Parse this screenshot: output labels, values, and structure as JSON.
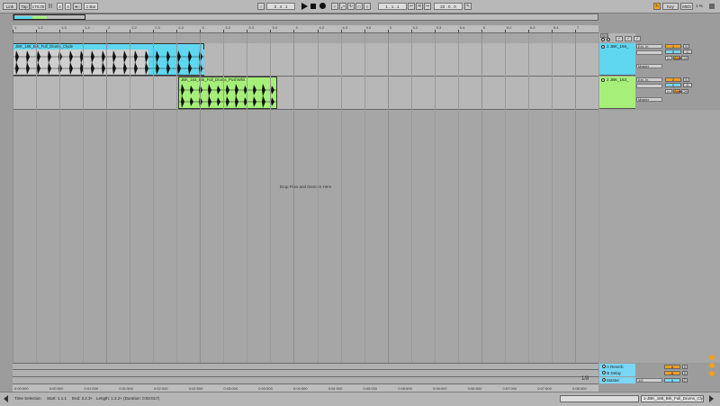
{
  "transport": {
    "link": "Link",
    "tap": "Tap",
    "tempo": "170.00",
    "time_sig_num": "4",
    "time_sig_den": "4",
    "quantize": "1 Bar",
    "position": "3 .   4 .   1",
    "loop_start": "1 .   1 .   1",
    "loop_length": "22 .   0 .   0",
    "key": "Key",
    "midi": "MIDI",
    "cpu": "1 %"
  },
  "ruler": {
    "bars": [
      "1",
      "1.2",
      "1.3",
      "1.4",
      "2",
      "2.2",
      "2.3",
      "2.4",
      "3",
      "3.2",
      "3.3",
      "3.4",
      "4",
      "4.2",
      "4.3",
      "4.4",
      "5",
      "5.2",
      "5.3",
      "5.4",
      "6",
      "6.2",
      "6.3",
      "6.4",
      "7"
    ]
  },
  "timeline": {
    "times": [
      "0:00:000",
      "0:00:500",
      "0:01:000",
      "0:01:500",
      "0:02:000",
      "0:02:500",
      "0:03:000",
      "0:03:500",
      "0:04:000",
      "0:04:500",
      "0:05:000",
      "0:05:500",
      "0:06:000",
      "0:06:500",
      "0:07:000",
      "0:07:500",
      "0:08:000"
    ]
  },
  "tracks": [
    {
      "name": "1 JBK_168_",
      "color": "#5fd7f0",
      "clip_name": "JBK_168_Brk_Full_Drums_Clyde",
      "input": "Ext. In",
      "input_ch": "1",
      "monitor": "Master",
      "volume": "0",
      "number": "1",
      "in": "In",
      "auto": "Auto",
      "off": "Off"
    },
    {
      "name": "2 JBK_163_",
      "color": "#a6f07a",
      "clip_name": "JBK_163_Brk_Full_Drums_PushWhit",
      "input": "Ext. In",
      "input_ch": "1",
      "monitor": "Master",
      "volume": "0",
      "number": "2",
      "in": "In",
      "auto": "Auto",
      "off": "Off"
    }
  ],
  "returns": [
    {
      "name": "A Reverb",
      "label": "A"
    },
    {
      "name": "B Delay",
      "label": "B"
    }
  ],
  "master": {
    "name": "Master",
    "fraction": "1/2",
    "page": "1/8"
  },
  "drop_hint": "Drop Files and Devices Here",
  "status": {
    "mode": "Time Selection",
    "start": "Start: 1.1.1",
    "end": "End: 3.2.3+",
    "length": "Length: 1.3.2+ (Duration: 0:02:017)",
    "clip_info": "1-JBK_168_Brk_Full_Drums_Clyde"
  },
  "set_button": "Set",
  "colors": {
    "track1": "#5fd7f0",
    "track2": "#a6f07a",
    "accent_orange": "#f0a020",
    "return_blue": "#7ad7f5"
  }
}
